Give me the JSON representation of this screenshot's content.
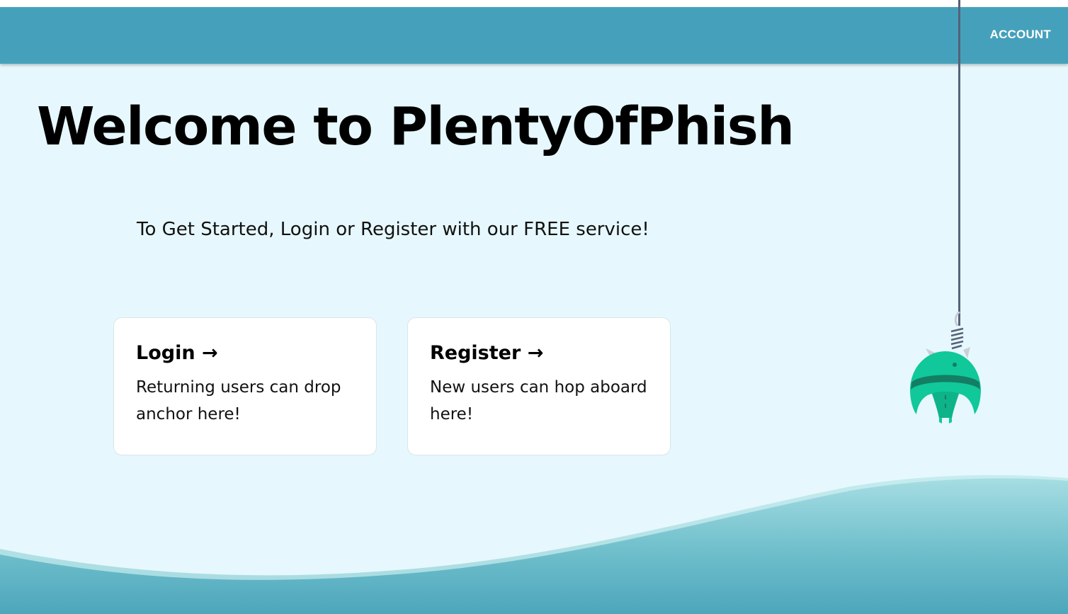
{
  "header": {
    "account_label": "ACCOUNT",
    "bg_color": "#45a1bb"
  },
  "main": {
    "title": "Welcome to PlentyOfPhish",
    "subtitle": "To Get Started, Login or Register with our FREE service!"
  },
  "cards": [
    {
      "title": "Login →",
      "text": "Returning users can drop anchor here!"
    },
    {
      "title": "Register →",
      "text": "New users can hop aboard here!"
    }
  ],
  "decor": {
    "fish_icon": "fish-on-hook",
    "wave_icon": "ocean-wave",
    "fish_color": "#10c89a",
    "wave_color": "#62b6c7"
  }
}
